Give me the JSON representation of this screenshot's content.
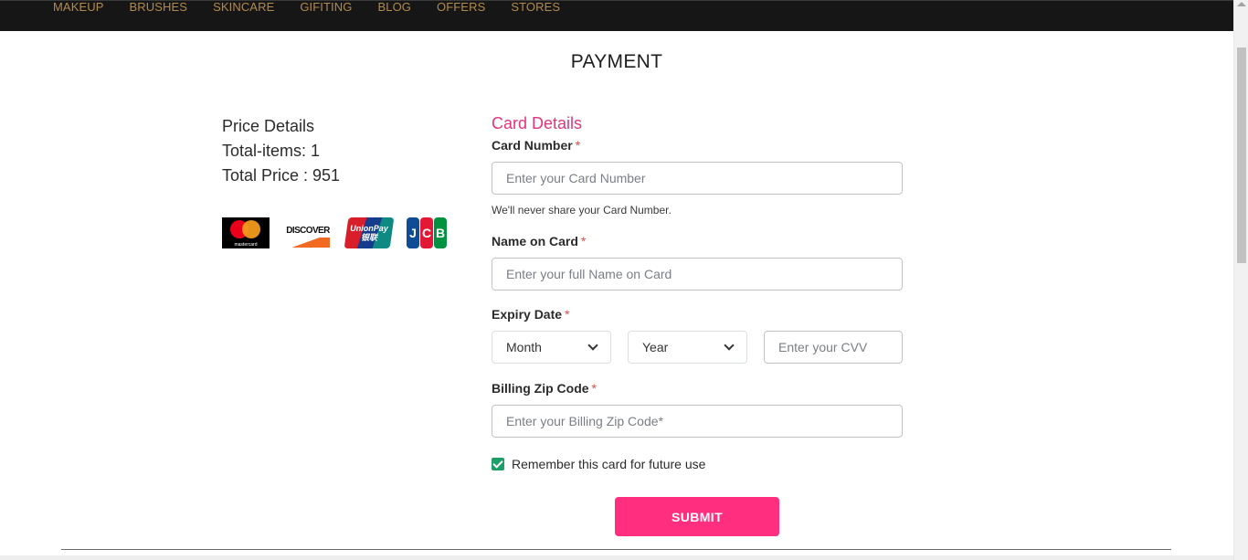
{
  "nav": {
    "items": [
      "MAKEUP",
      "BRUSHES",
      "SKINCARE",
      "GIFITING",
      "BLOG",
      "OFFERS",
      "STORES"
    ]
  },
  "page": {
    "title": "PAYMENT"
  },
  "price": {
    "heading": "Price Details",
    "total_items": "Total-items: 1",
    "total_price": "Total Price : 951"
  },
  "card_logos": [
    {
      "name": "mastercard",
      "text": "mastercard"
    },
    {
      "name": "discover",
      "text": "DISCOVER"
    },
    {
      "name": "unionpay",
      "text": "UnionPay 银联"
    },
    {
      "name": "jcb",
      "text": "JCB"
    }
  ],
  "form": {
    "section_title": "Card Details",
    "card_number": {
      "label": "Card Number",
      "required": "*",
      "placeholder": "Enter your Card Number",
      "value": "",
      "help": "We'll never share your Card Number."
    },
    "name_on_card": {
      "label": "Name on Card",
      "required": "*",
      "placeholder": "Enter your full Name on Card",
      "value": ""
    },
    "expiry": {
      "label": "Expiry Date",
      "required": "*",
      "month_selected": "Month",
      "year_selected": "Year",
      "cvv_placeholder": "Enter your CVV"
    },
    "zip": {
      "label": "Billing Zip Code",
      "required": "*",
      "placeholder": "Enter your Billing Zip Code*",
      "value": ""
    },
    "remember": {
      "label": "Remember this card for future use",
      "checked": true
    },
    "submit_label": "SUBMIT"
  },
  "colors": {
    "nav_bg": "#161616",
    "nav_text": "#b28a4b",
    "accent_pink": "#ff2e7e",
    "section_title": "#e4347b",
    "checkbox": "#1e9f6a"
  }
}
